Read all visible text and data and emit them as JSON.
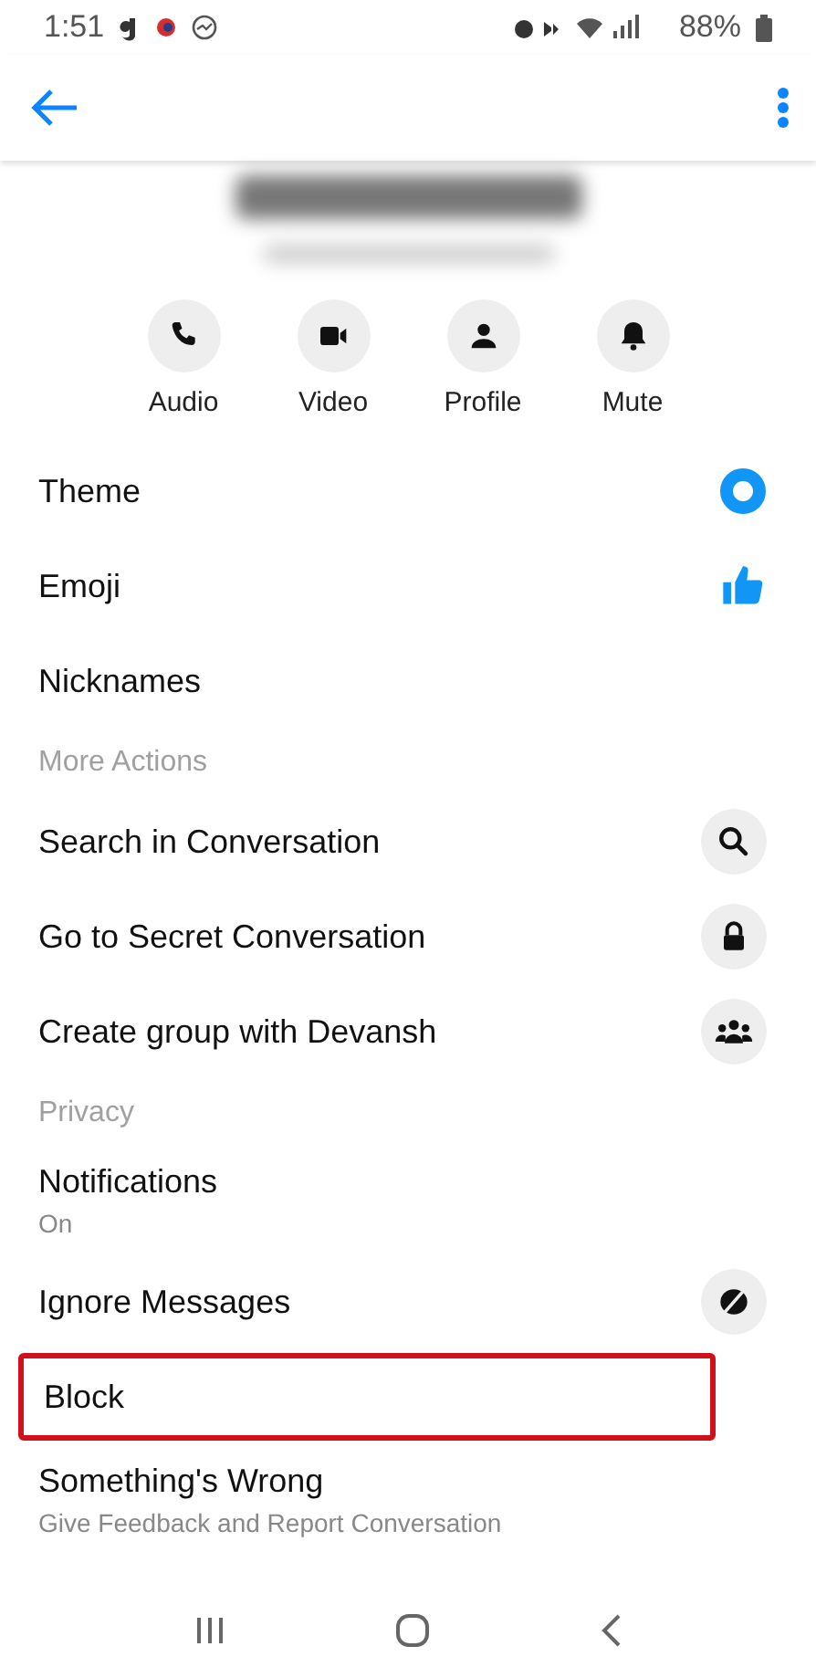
{
  "status_bar": {
    "time": "1:51",
    "battery": "88%"
  },
  "actions": [
    {
      "label": "Audio"
    },
    {
      "label": "Video"
    },
    {
      "label": "Profile"
    },
    {
      "label": "Mute"
    }
  ],
  "sections": [
    {
      "items": [
        {
          "label": "Theme",
          "kind": "theme"
        },
        {
          "label": "Emoji",
          "kind": "emoji"
        },
        {
          "label": "Nicknames",
          "kind": "plain"
        }
      ]
    },
    {
      "header": "More Actions",
      "items": [
        {
          "label": "Search in Conversation",
          "kind": "search"
        },
        {
          "label": "Go to Secret Conversation",
          "kind": "lock"
        },
        {
          "label": "Create group with Devansh",
          "kind": "group"
        }
      ]
    },
    {
      "header": "Privacy",
      "items": [
        {
          "label": "Notifications",
          "subtitle": "On",
          "kind": "plain"
        },
        {
          "label": "Ignore Messages",
          "kind": "ignore"
        },
        {
          "label": "Block",
          "kind": "plain",
          "highlighted": true
        },
        {
          "label": "Something's Wrong",
          "subtitle": "Give Feedback and Report Conversation",
          "kind": "plain"
        }
      ]
    }
  ]
}
